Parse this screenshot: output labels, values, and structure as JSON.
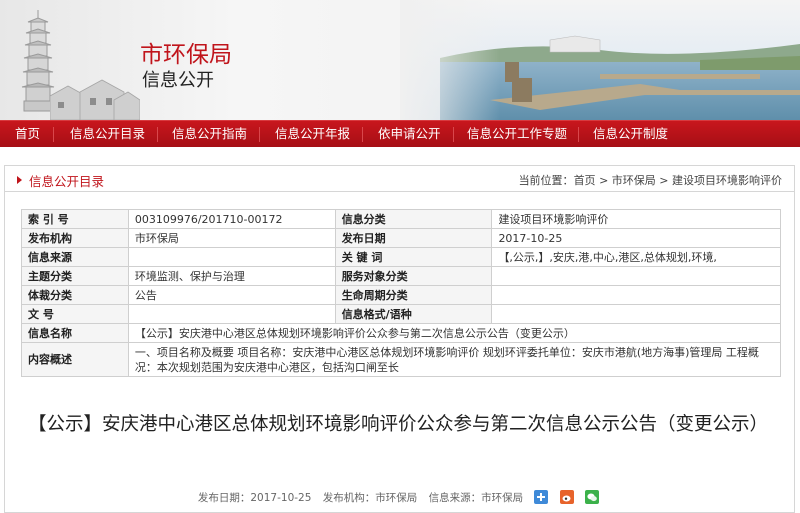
{
  "header": {
    "title": "市环保局",
    "subtitle": "信息公开"
  },
  "nav": {
    "items": [
      {
        "label": "首页"
      },
      {
        "label": "信息公开目录"
      },
      {
        "label": "信息公开指南"
      },
      {
        "label": "信息公开年报"
      },
      {
        "label": "依申请公开"
      },
      {
        "label": "信息公开工作专题"
      },
      {
        "label": "信息公开制度"
      }
    ]
  },
  "section": {
    "title": "信息公开目录",
    "location_label": "当前位置：",
    "breadcrumb": [
      "首页",
      "市环保局",
      "建设项目环境影响评价"
    ],
    "separator": ">"
  },
  "info_table": {
    "rows": [
      {
        "l1": "索 引 号",
        "v1": "003109976/201710-00172",
        "l2": "信息分类",
        "v2": "建设项目环境影响评价"
      },
      {
        "l1": "发布机构",
        "v1": "市环保局",
        "l2": "发布日期",
        "v2": "2017-10-25"
      },
      {
        "l1": "信息来源",
        "v1": "",
        "l2": "关 键 词",
        "v2": "【,公示,】,安庆,港,中心,港区,总体规划,环境,"
      },
      {
        "l1": "主题分类",
        "v1": "环境监测、保护与治理",
        "l2": "服务对象分类",
        "v2": ""
      },
      {
        "l1": "体裁分类",
        "v1": "公告",
        "l2": "生命周期分类",
        "v2": ""
      },
      {
        "l1": "文 号",
        "v1": "",
        "l2": "信息格式/语种",
        "v2": ""
      }
    ],
    "name_label": "信息名称",
    "name_value": "【公示】安庆港中心港区总体规划环境影响评价公众参与第二次信息公示公告（变更公示）",
    "summary_label": "内容概述",
    "summary_value": "一、项目名称及概要 项目名称：安庆港中心港区总体规划环境影响评价 规划环评委托单位：安庆市港航(地方海事)管理局 工程概况：本次规划范围为安庆港中心港区，包括沟口闸至长"
  },
  "document": {
    "title": "【公示】安庆港中心港区总体规划环境影响评价公众参与第二次信息公示公告（变更公示）",
    "publish_date": "发布日期：2017-10-25",
    "publisher": "发布机构：市环保局",
    "source": "信息来源：市环保局"
  },
  "colors": {
    "brand_red": "#c0141b",
    "nav_red": "#b3131a"
  }
}
